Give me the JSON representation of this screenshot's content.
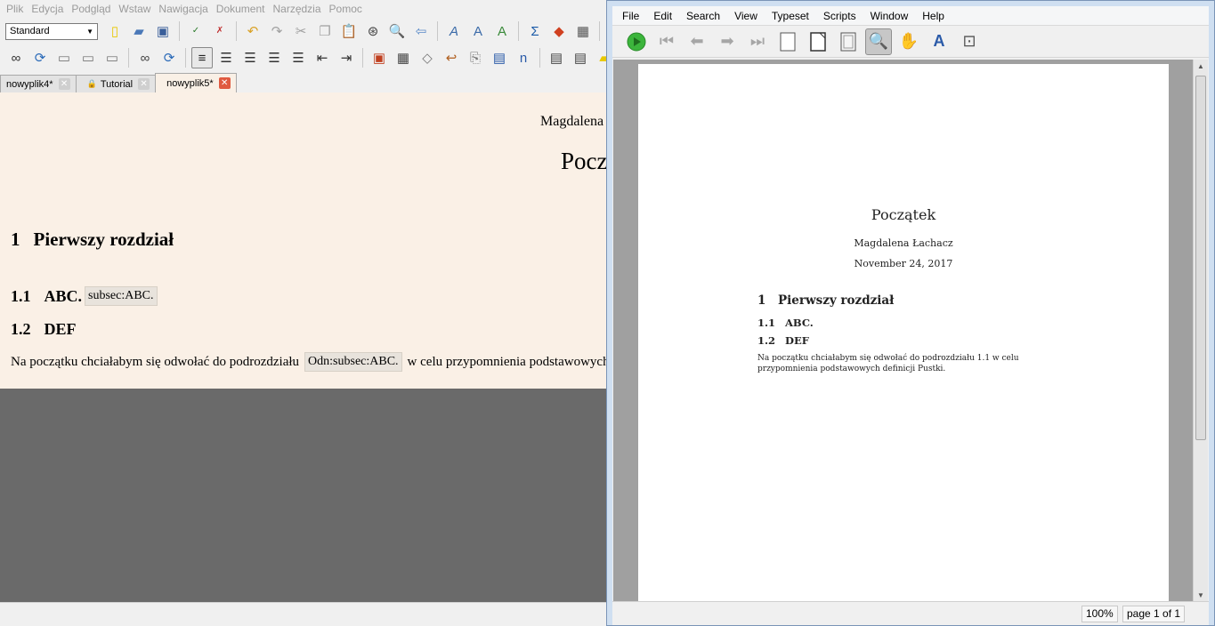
{
  "lyx": {
    "menu": [
      "Plik",
      "Edycja",
      "Podgląd",
      "Wstaw",
      "Nawigacja",
      "Dokument",
      "Narzędzia",
      "Pomoc"
    ],
    "layout_select": "Standard",
    "tabs": [
      {
        "label": "nowyplik4*",
        "active": false
      },
      {
        "label": "Tutorial",
        "active": false
      },
      {
        "label": "nowyplik5*",
        "active": true
      }
    ],
    "doc": {
      "author": "Magdalena",
      "title": "Pocz",
      "sec1_num": "1",
      "sec1": "Pierwszy rozdział",
      "sub1_num": "1.1",
      "sub1": "ABC.",
      "sub1_label": "subsec:ABC.",
      "sub2_num": "1.2",
      "sub2": "DEF",
      "para_before": "Na początku chciałabym się odwołać do podrozdziału",
      "para_ref": "Odn:subsec:ABC.",
      "para_after": "w celu przypomnienia podstawowych"
    }
  },
  "texworks": {
    "menu": [
      "File",
      "Edit",
      "Search",
      "View",
      "Typeset",
      "Scripts",
      "Window",
      "Help"
    ],
    "pdf": {
      "title": "Początek",
      "author": "Magdalena Łachacz",
      "date": "November 24, 2017",
      "sec1_num": "1",
      "sec1": "Pierwszy rozdział",
      "sub1_num": "1.1",
      "sub1": "ABC.",
      "sub2_num": "1.2",
      "sub2": "DEF",
      "body": "Na początku chciałabym się odwołać do podrozdziału 1.1 w celu przypomnienia podstawowych definicji Pustki."
    },
    "zoom": "100%",
    "page_status": "page 1 of 1"
  },
  "colors": {
    "lyx_doc_bg": "#faf0e6",
    "lyx_gray": "#6a6a6a",
    "tw_frame": "#cfdff1",
    "typeset_green": "#3cb53c"
  }
}
